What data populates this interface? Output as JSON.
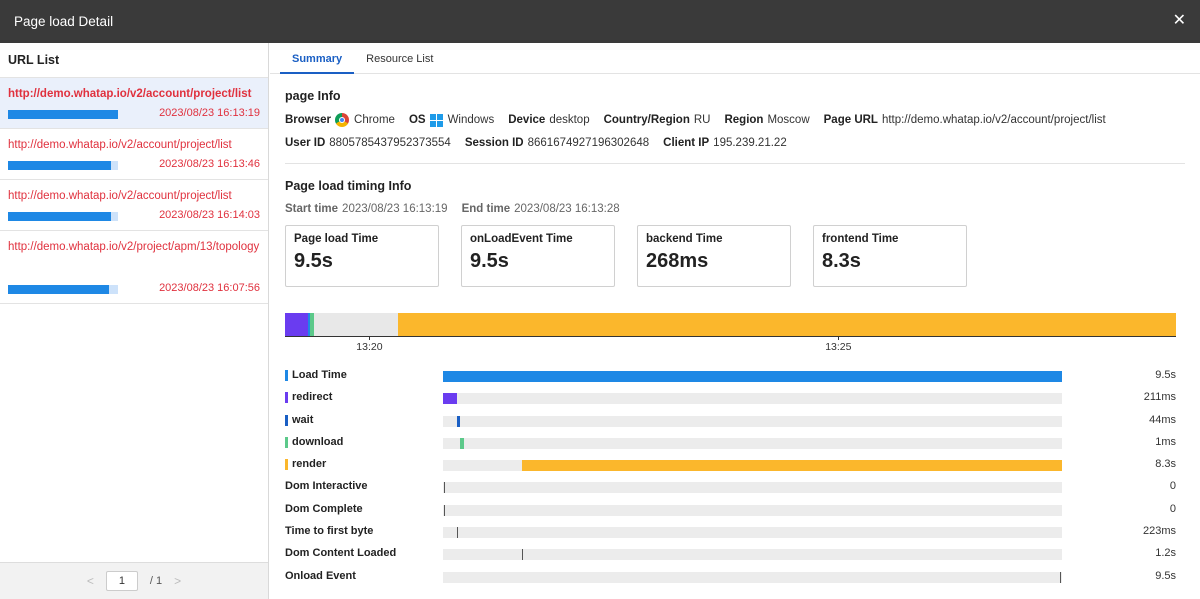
{
  "window": {
    "title": "Page load Detail"
  },
  "sidebar": {
    "title": "URL List",
    "items": [
      {
        "url": "http://demo.whatap.io/v2/account/project/list",
        "time": "2023/08/23 16:13:19",
        "progress": 1.0,
        "active": true
      },
      {
        "url": "http://demo.whatap.io/v2/account/project/list",
        "time": "2023/08/23 16:13:46",
        "progress": 0.94,
        "active": false
      },
      {
        "url": "http://demo.whatap.io/v2/account/project/list",
        "time": "2023/08/23 16:14:03",
        "progress": 0.94,
        "active": false
      },
      {
        "url": "http://demo.whatap.io/v2/project/apm/13/topology",
        "time": "2023/08/23 16:07:56",
        "progress": 0.92,
        "active": false
      }
    ],
    "pager": {
      "prev": "<",
      "page": "1",
      "total": "/ 1",
      "next": ">"
    }
  },
  "tabs": [
    {
      "label": "Summary",
      "active": true
    },
    {
      "label": "Resource List",
      "active": false
    }
  ],
  "page_info": {
    "title": "page Info",
    "browser_label": "Browser",
    "browser": "Chrome",
    "os_label": "OS",
    "os": "Windows",
    "device_label": "Device",
    "device": "desktop",
    "country_label": "Country/Region",
    "country": "RU",
    "region_label": "Region",
    "region": "Moscow",
    "page_url_label": "Page URL",
    "page_url": "http://demo.whatap.io/v2/account/project/list",
    "user_id_label": "User ID",
    "user_id": "8805785437952373554",
    "session_id_label": "Session ID",
    "session_id": "8661674927196302648",
    "client_ip_label": "Client IP",
    "client_ip": "195.239.21.22"
  },
  "timing_info": {
    "title": "Page load timing Info",
    "start_label": "Start time",
    "start": "2023/08/23 16:13:19",
    "end_label": "End time",
    "end": "2023/08/23 16:13:28",
    "cards": [
      {
        "label": "Page load Time",
        "value": "9.5s"
      },
      {
        "label": "onLoadEvent Time",
        "value": "9.5s"
      },
      {
        "label": "backend Time",
        "value": "268ms"
      },
      {
        "label": "frontend Time",
        "value": "8.3s"
      }
    ]
  },
  "timeline": {
    "total_s": 9.5,
    "segments": [
      {
        "name": "redirect",
        "start_s": 0.0,
        "dur_s": 0.25,
        "color": "#6a3cf0"
      },
      {
        "name": "wait",
        "start_s": 0.25,
        "dur_s": 0.02,
        "color": "#1e88e5"
      },
      {
        "name": "download",
        "start_s": 0.27,
        "dur_s": 0.04,
        "color": "#5cc98a"
      },
      {
        "name": "render",
        "start_s": 1.2,
        "dur_s": 8.3,
        "color": "#fbb72c"
      }
    ],
    "ticks": [
      {
        "label": "13:20",
        "at_s": 0.9
      },
      {
        "label": "13:25",
        "at_s": 5.9
      }
    ]
  },
  "metrics": [
    {
      "label": "Load Time",
      "value": "9.5s",
      "color": "#1e88e5",
      "type": "bar",
      "start": 0.0,
      "end": 1.0
    },
    {
      "label": "redirect",
      "value": "211ms",
      "color": "#6a3cf0",
      "type": "bar",
      "start": 0.0,
      "end": 0.022
    },
    {
      "label": "wait",
      "value": "44ms",
      "color": "#1a5fc4",
      "type": "bar",
      "start": 0.022,
      "end": 0.028
    },
    {
      "label": "download",
      "value": "1ms",
      "color": "#5cc98a",
      "type": "bar",
      "start": 0.028,
      "end": 0.034
    },
    {
      "label": "render",
      "value": "8.3s",
      "color": "#fbb72c",
      "type": "bar",
      "start": 0.127,
      "end": 1.0
    },
    {
      "label": "Dom Interactive",
      "value": "0",
      "type": "line",
      "at": 0.002
    },
    {
      "label": "Dom Complete",
      "value": "0",
      "type": "line",
      "at": 0.002
    },
    {
      "label": "Time to first byte",
      "value": "223ms",
      "type": "line",
      "at": 0.023
    },
    {
      "label": "Dom Content Loaded",
      "value": "1.2s",
      "type": "line",
      "at": 0.127
    },
    {
      "label": "Onload Event",
      "value": "9.5s",
      "type": "line",
      "at": 0.997
    }
  ]
}
